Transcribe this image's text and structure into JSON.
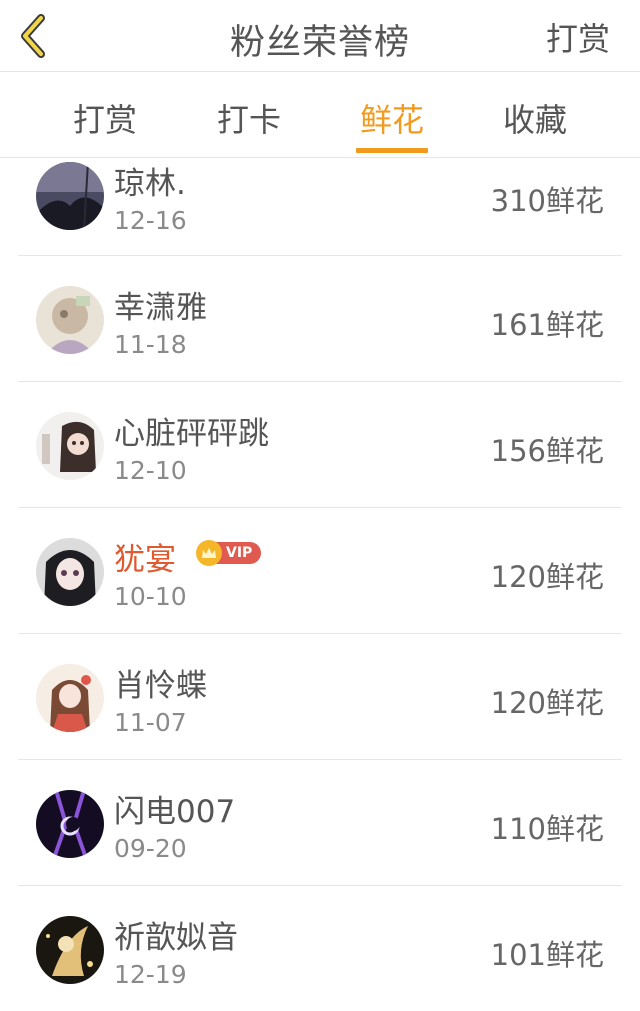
{
  "header": {
    "title": "粉丝荣誉榜",
    "action": "打赏"
  },
  "tabs": [
    {
      "label": "打赏",
      "active": false
    },
    {
      "label": "打卡",
      "active": false
    },
    {
      "label": "鲜花",
      "active": true
    },
    {
      "label": "收藏",
      "active": false
    }
  ],
  "colors": {
    "accent": "#f19b1e",
    "vip_name": "#e0592f",
    "vip_badge": "#e05a4f"
  },
  "list": [
    {
      "name": "琼林.",
      "date": "12-16",
      "count": "310鲜花"
    },
    {
      "name": "幸潇雅",
      "date": "11-18",
      "count": "161鲜花"
    },
    {
      "name": "心脏砰砰跳",
      "date": "12-10",
      "count": "156鲜花"
    },
    {
      "name": "犹宴",
      "date": "10-10",
      "count": "120鲜花",
      "vip": "VIP"
    },
    {
      "name": "肖怜蝶",
      "date": "11-07",
      "count": "120鲜花"
    },
    {
      "name": "闪电007",
      "date": "09-20",
      "count": "110鲜花"
    },
    {
      "name": "祈歆姒音",
      "date": "12-19",
      "count": "101鲜花"
    }
  ]
}
